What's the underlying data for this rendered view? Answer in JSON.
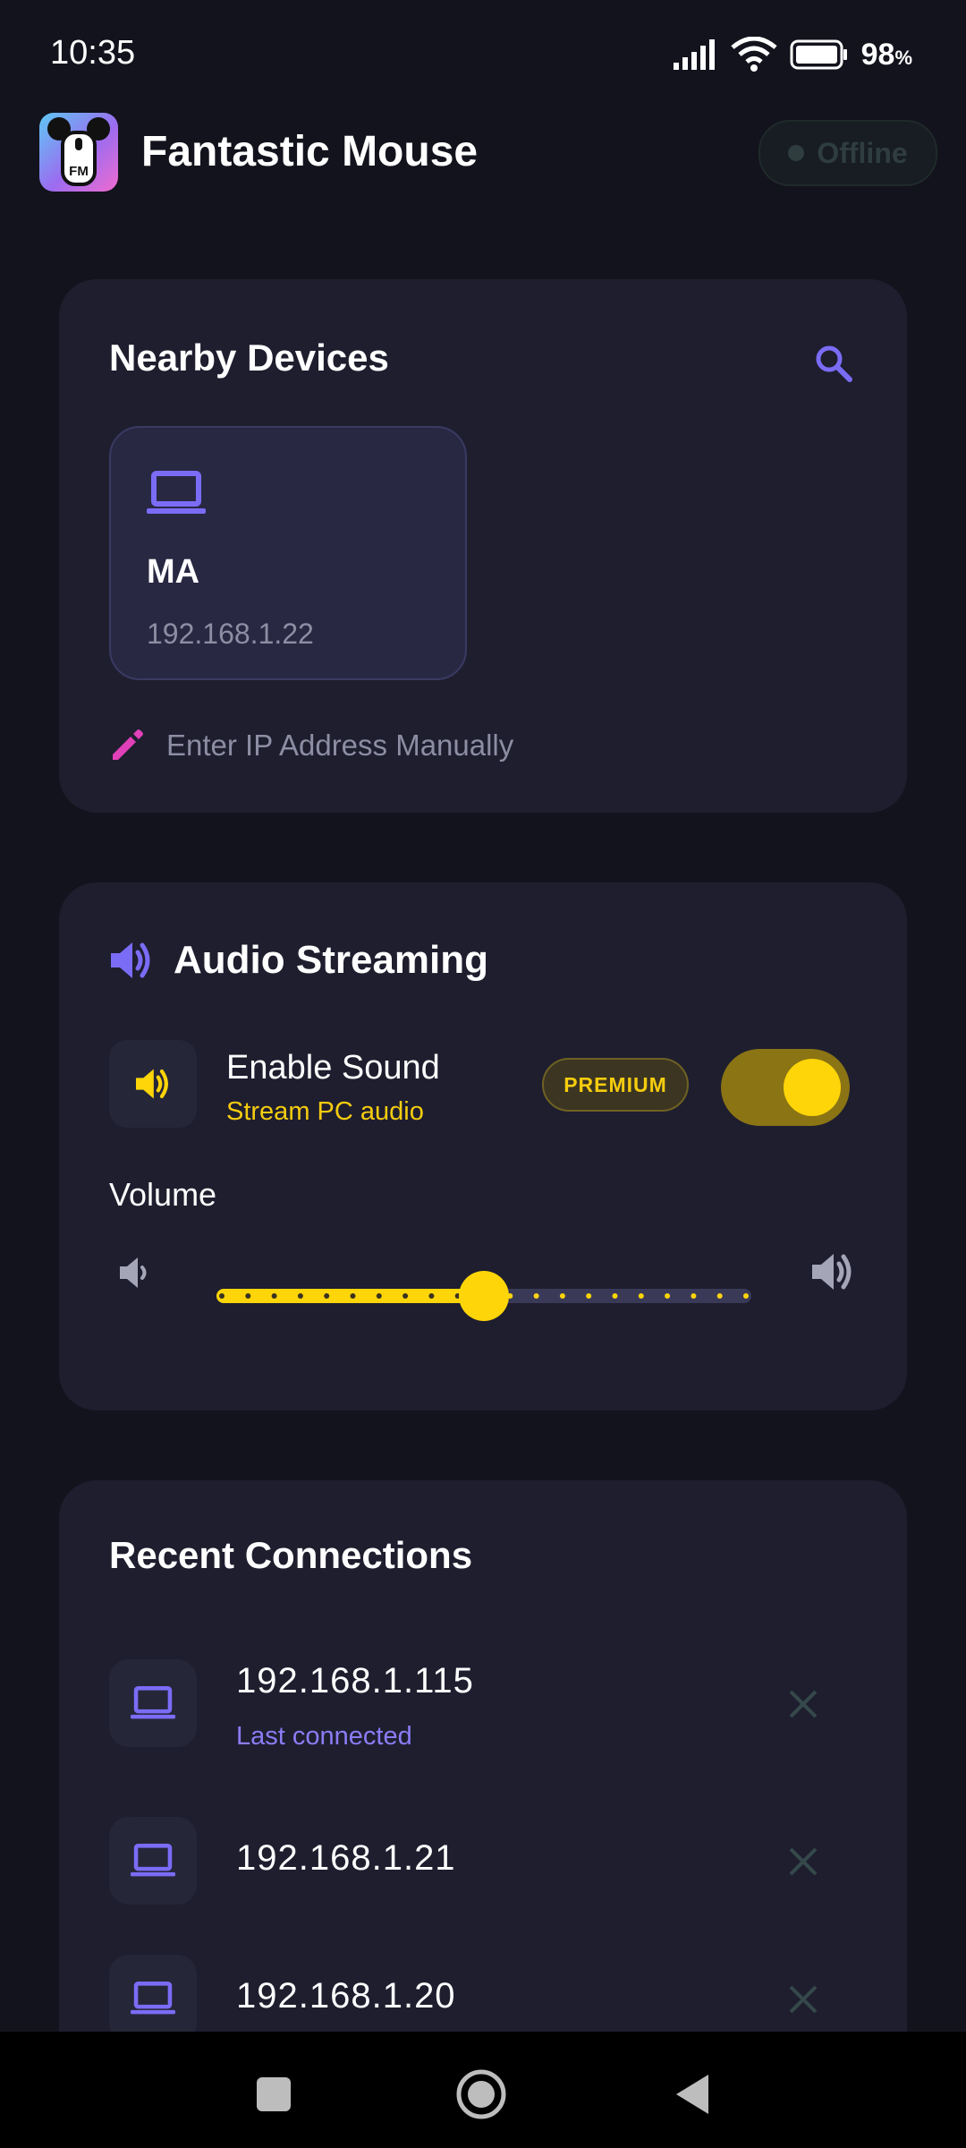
{
  "status_bar": {
    "time": "10:35",
    "battery_value": "98",
    "battery_unit": "%"
  },
  "app": {
    "title": "Fantastic Mouse",
    "logo_text": "FM",
    "connection_status": "Offline"
  },
  "nearby": {
    "title": "Nearby Devices",
    "devices": [
      {
        "name": "MA",
        "ip": "192.168.1.22"
      }
    ],
    "manual_entry_label": "Enter IP Address Manually"
  },
  "audio": {
    "title": "Audio Streaming",
    "enable_label": "Enable Sound",
    "enable_sublabel": "Stream PC audio",
    "premium_badge": "PREMIUM",
    "enabled": true,
    "volume_label": "Volume",
    "volume_level": 0.5
  },
  "recent": {
    "title": "Recent Connections",
    "items": [
      {
        "ip": "192.168.1.115",
        "subtitle": "Last connected"
      },
      {
        "ip": "192.168.1.21"
      },
      {
        "ip": "192.168.1.20"
      }
    ]
  },
  "colors": {
    "accent": "#7b6cf6",
    "premium": "#fdd508",
    "background": "#13131d",
    "card": "#1e1e2f"
  }
}
